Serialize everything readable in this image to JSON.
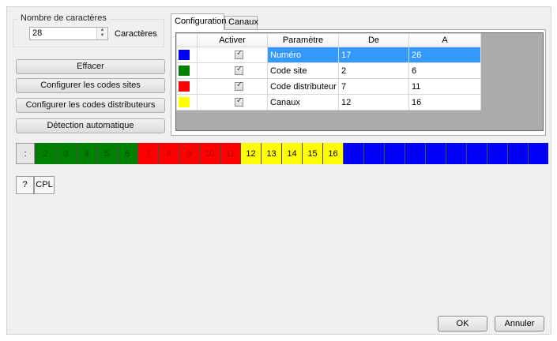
{
  "char_count": {
    "group_title": "Nombre de caractères",
    "value": "28",
    "unit": "Caractères"
  },
  "buttons": {
    "clear": "Effacer",
    "site_codes": "Configurer les codes sites",
    "distributor_codes": "Configurer les codes distributeurs",
    "auto_detect": "Détection automatique"
  },
  "tabs": [
    {
      "label": "Configuration",
      "active": true
    },
    {
      "label": "Canaux",
      "active": false
    }
  ],
  "table": {
    "headers": [
      "",
      "Activer",
      "Paramètre",
      "De",
      "A"
    ],
    "rows": [
      {
        "color": "#0000ff",
        "checked": true,
        "param": "Numéro",
        "from": "17",
        "to": "26",
        "selected": true
      },
      {
        "color": "#008000",
        "checked": true,
        "param": "Code site",
        "from": "2",
        "to": "6",
        "selected": false
      },
      {
        "color": "#ff0000",
        "checked": true,
        "param": "Code distributeur",
        "from": "7",
        "to": "11",
        "selected": false
      },
      {
        "color": "#ffff00",
        "checked": true,
        "param": "Canaux",
        "from": "12",
        "to": "16",
        "selected": false
      }
    ]
  },
  "strip": {
    "first": ":",
    "cells": [
      {
        "label": "2",
        "color": "#008000"
      },
      {
        "label": "3",
        "color": "#008000"
      },
      {
        "label": "4",
        "color": "#008000"
      },
      {
        "label": "5",
        "color": "#008000"
      },
      {
        "label": "6",
        "color": "#008000"
      },
      {
        "label": "7",
        "color": "#ff0000"
      },
      {
        "label": "8",
        "color": "#ff0000"
      },
      {
        "label": "9",
        "color": "#ff0000"
      },
      {
        "label": "10",
        "color": "#ff0000"
      },
      {
        "label": "11",
        "color": "#ff0000"
      },
      {
        "label": "12",
        "color": "#ffff00"
      },
      {
        "label": "13",
        "color": "#ffff00"
      },
      {
        "label": "14",
        "color": "#ffff00"
      },
      {
        "label": "15",
        "color": "#ffff00"
      },
      {
        "label": "16",
        "color": "#ffff00"
      },
      {
        "label": "17",
        "color": "#0000ff"
      },
      {
        "label": "18",
        "color": "#0000ff"
      },
      {
        "label": "19",
        "color": "#0000ff"
      },
      {
        "label": "20",
        "color": "#0000ff"
      },
      {
        "label": "21",
        "color": "#0000ff"
      },
      {
        "label": "22",
        "color": "#0000ff"
      },
      {
        "label": "23",
        "color": "#0000ff"
      },
      {
        "label": "24",
        "color": "#0000ff"
      },
      {
        "label": "25",
        "color": "#0000ff"
      },
      {
        "label": "26",
        "color": "#0000ff"
      }
    ]
  },
  "small_buttons": {
    "help": "?",
    "cpl": "CPL"
  },
  "footer": {
    "ok": "OK",
    "cancel": "Annuler"
  }
}
